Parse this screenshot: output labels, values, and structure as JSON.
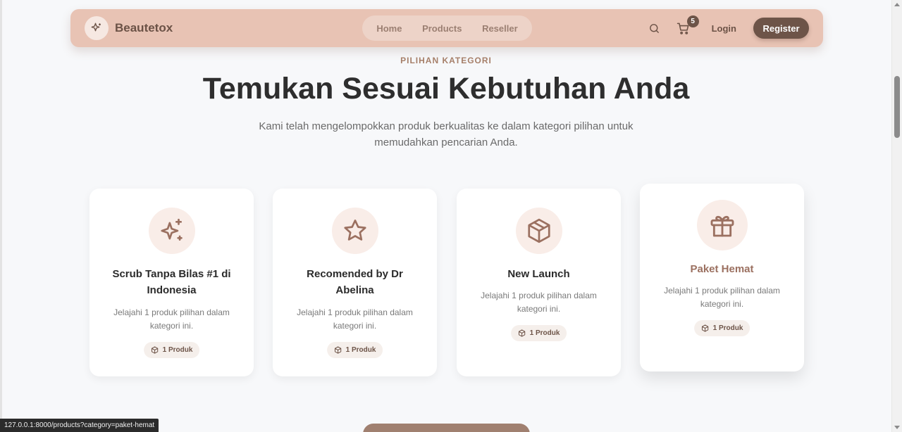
{
  "nav": {
    "brand": "Beautetox",
    "links": [
      "Home",
      "Products",
      "Reseller"
    ],
    "cart_count": "5",
    "login": "Login",
    "register": "Register"
  },
  "hero": {
    "eyebrow": "PILIHAN KATEGORI",
    "title": "Temukan Sesuai Kebutuhan Anda",
    "subtitle": "Kami telah mengelompokkan produk berkualitas ke dalam kategori pilihan untuk memudahkan pencarian Anda."
  },
  "categories": [
    {
      "icon": "sparkles-icon",
      "title": "Scrub Tanpa Bilas #1 di Indonesia",
      "description": "Jelajahi 1 produk pilihan dalam kategori ini.",
      "count": "1 Produk"
    },
    {
      "icon": "star-icon",
      "title": "Recomended by Dr Abelina",
      "description": "Jelajahi 1 produk pilihan dalam kategori ini.",
      "count": "1 Produk"
    },
    {
      "icon": "box-icon",
      "title": "New Launch",
      "description": "Jelajahi 1 produk pilihan dalam kategori ini.",
      "count": "1 Produk"
    },
    {
      "icon": "gift-icon",
      "title": "Paket Hemat",
      "description": "Jelajahi 1 produk pilihan dalam kategori ini.",
      "count": "1 Produk"
    }
  ],
  "status_url": "127.0.0.1:8000/products?category=paket-hemat",
  "colors": {
    "accent": "#6d5448",
    "navbar": "#e8c3b4",
    "icon_bg": "#f9ede8",
    "icon_stroke": "#9b7060"
  }
}
